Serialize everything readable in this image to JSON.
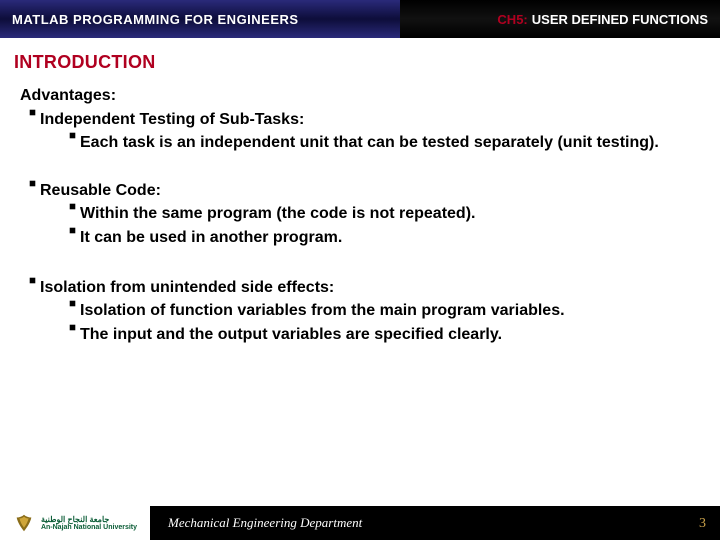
{
  "header": {
    "left": "MATLAB PROGRAMMING FOR ENGINEERS",
    "ch_prefix": "CH5:",
    "right": "USER DEFINED FUNCTIONS"
  },
  "section_title": "INTRODUCTION",
  "content": {
    "lead": "Advantages:",
    "blocks": [
      {
        "heading": "Independent Testing of Sub-Tasks:",
        "subs": [
          "Each task is an independent unit that can be tested separately (unit testing)."
        ]
      },
      {
        "heading": "Reusable Code:",
        "subs": [
          "Within the same program (the code is not repeated).",
          "It can be used in another program."
        ]
      },
      {
        "heading": "Isolation from unintended side effects:",
        "subs": [
          "Isolation of function variables from the main program variables.",
          "The input and the output variables are specified clearly."
        ]
      }
    ]
  },
  "footer": {
    "uni_ar": "جامعة النجاح الوطنية",
    "uni_en": "An-Najah National University",
    "dept": "Mechanical Engineering Department",
    "page": "3"
  }
}
